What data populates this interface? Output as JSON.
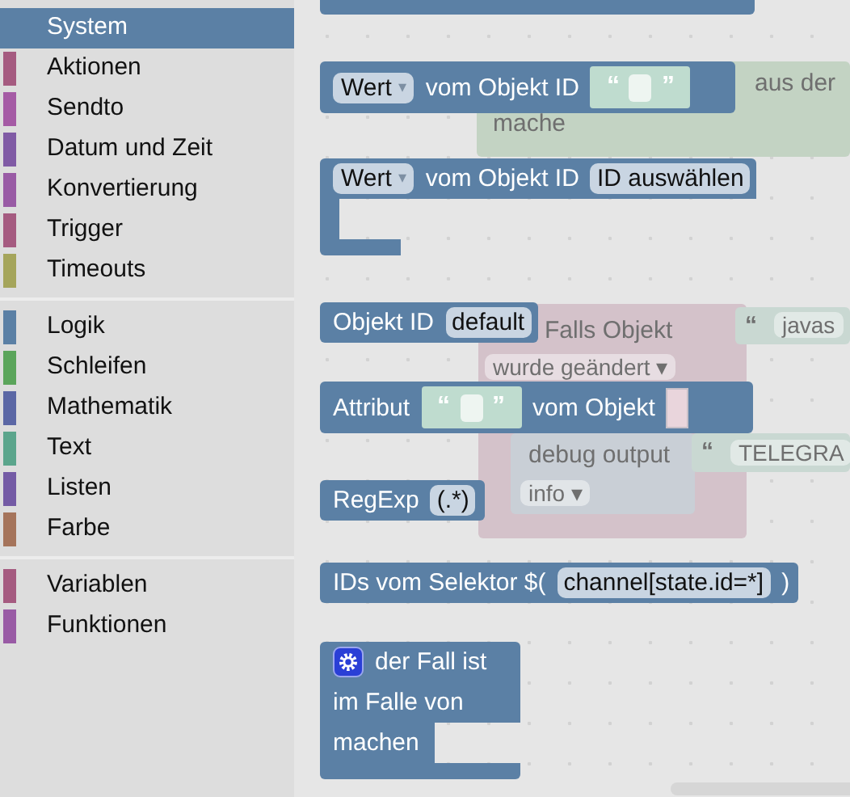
{
  "toolbox": {
    "groups": [
      {
        "categories": [
          {
            "label": "System",
            "color": "#5b80a5",
            "selected": true
          },
          {
            "label": "Aktionen",
            "color": "#a55b80",
            "selected": false
          },
          {
            "label": "Sendto",
            "color": "#a55ba5",
            "selected": false
          },
          {
            "label": "Datum und Zeit",
            "color": "#805ba5",
            "selected": false
          },
          {
            "label": "Konvertierung",
            "color": "#995ba5",
            "selected": false
          },
          {
            "label": "Trigger",
            "color": "#a55b80",
            "selected": false
          },
          {
            "label": "Timeouts",
            "color": "#a5a55b",
            "selected": false
          }
        ]
      },
      {
        "categories": [
          {
            "label": "Logik",
            "color": "#5b80a5",
            "selected": false
          },
          {
            "label": "Schleifen",
            "color": "#5ba55b",
            "selected": false
          },
          {
            "label": "Mathematik",
            "color": "#5b67a5",
            "selected": false
          },
          {
            "label": "Text",
            "color": "#5ba58c",
            "selected": false
          },
          {
            "label": "Listen",
            "color": "#745ba5",
            "selected": false
          },
          {
            "label": "Farbe",
            "color": "#a5745b",
            "selected": false
          }
        ]
      },
      {
        "categories": [
          {
            "label": "Variablen",
            "color": "#a55b80",
            "selected": false
          },
          {
            "label": "Funktionen",
            "color": "#995ba5",
            "selected": false
          }
        ]
      }
    ]
  },
  "workspace": {
    "blocks": [
      {
        "kind": "loop",
        "pieces": [
          {
            "kind": "label",
            "text": "aus der"
          },
          {
            "kind": "label",
            "text": "mache"
          }
        ]
      },
      {
        "kind": "trigger",
        "pieces": [
          {
            "kind": "label",
            "text": "Falls Objekt"
          },
          {
            "kind": "dropdown",
            "text": "wurde geändert",
            "arrow": "▾"
          }
        ]
      },
      {
        "kind": "action",
        "pieces": [
          {
            "kind": "label",
            "text": "debug output"
          },
          {
            "kind": "dropdown",
            "text": "info",
            "arrow": "▾"
          }
        ]
      },
      {
        "kind": "text",
        "pieces": [
          {
            "kind": "quote",
            "text": "“"
          },
          {
            "kind": "field",
            "text": "javas"
          }
        ]
      },
      {
        "kind": "text",
        "pieces": [
          {
            "kind": "quote",
            "text": "“"
          },
          {
            "kind": "field",
            "text": "TELEGRA"
          }
        ]
      }
    ]
  },
  "flyout": {
    "blocks": [
      {
        "rows": [
          {
            "kind": "inputs"
          }
        ]
      },
      {
        "rows": [
          {
            "kind": "inputs",
            "parts": [
              {
                "kind": "dropdown",
                "text": "Wert",
                "arrow": "▾"
              },
              {
                "kind": "label",
                "text": "vom Objekt ID"
              },
              {
                "kind": "string",
                "open": "“",
                "close": "”"
              }
            ]
          }
        ]
      },
      {
        "rows": [
          {
            "kind": "inputs",
            "parts": [
              {
                "kind": "dropdown",
                "text": "Wert",
                "arrow": "▾"
              },
              {
                "kind": "label",
                "text": "vom Objekt ID"
              },
              {
                "kind": "field",
                "text": "ID auswählen"
              }
            ]
          },
          {
            "kind": "statement"
          }
        ]
      },
      {
        "rows": [
          {
            "kind": "inputs",
            "parts": [
              {
                "kind": "label",
                "text": "Objekt ID"
              },
              {
                "kind": "field",
                "text": "default"
              }
            ]
          }
        ]
      },
      {
        "rows": [
          {
            "kind": "inputs",
            "parts": [
              {
                "kind": "label",
                "text": "Attribut"
              },
              {
                "kind": "string",
                "open": "“",
                "close": "”"
              },
              {
                "kind": "label",
                "text": "vom Objekt"
              },
              {
                "kind": "socket"
              }
            ]
          }
        ]
      },
      {
        "rows": [
          {
            "kind": "inputs",
            "parts": [
              {
                "kind": "label",
                "text": "RegExp"
              },
              {
                "kind": "field",
                "text": "(.*)"
              }
            ]
          }
        ]
      },
      {
        "rows": [
          {
            "kind": "inputs",
            "parts": [
              {
                "kind": "label",
                "text": "IDs vom Selektor $("
              },
              {
                "kind": "field",
                "text": "channel[state.id=*]"
              },
              {
                "kind": "label",
                "text": ")"
              }
            ]
          }
        ]
      },
      {
        "rows": [
          {
            "kind": "inputs",
            "parts": [
              {
                "kind": "gear"
              },
              {
                "kind": "label",
                "text": "der Fall ist"
              }
            ]
          },
          {
            "kind": "inputs",
            "parts": [
              {
                "kind": "label",
                "text": "im Falle von"
              }
            ]
          },
          {
            "kind": "statement",
            "parts": [
              {
                "kind": "label",
                "text": "machen"
              }
            ]
          }
        ]
      }
    ]
  }
}
